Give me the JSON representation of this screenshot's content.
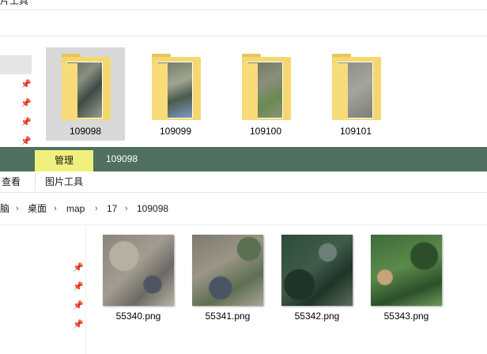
{
  "top_window": {
    "title_fragment": "片工具",
    "folders": [
      {
        "name": "109098",
        "selected": true
      },
      {
        "name": "109099",
        "selected": false
      },
      {
        "name": "109100",
        "selected": false
      },
      {
        "name": "109101",
        "selected": false
      }
    ]
  },
  "ribbon": {
    "context_tab": "管理",
    "folder_title": "109098",
    "view_label": "查看",
    "picture_tools_label": "图片工具"
  },
  "address_bar": {
    "crumbs": [
      "脑",
      "桌面",
      "map",
      "17",
      "109098"
    ]
  },
  "files": [
    {
      "name": "55340.png",
      "palette": [
        "#8a857c",
        "#a39c8f",
        "#6b6a66",
        "#b8b2a4"
      ]
    },
    {
      "name": "55341.png",
      "palette": [
        "#7d7a6e",
        "#9a9586",
        "#5e6f52",
        "#a8a597"
      ]
    },
    {
      "name": "55342.png",
      "palette": [
        "#2e4a3a",
        "#3f5c4a",
        "#1f3328",
        "#5b6e5a"
      ]
    },
    {
      "name": "55343.png",
      "palette": [
        "#3f6b3a",
        "#5a8a4a",
        "#2c4f2a",
        "#c7a27a"
      ]
    }
  ],
  "colors": {
    "context_bar": "#4f6f5f",
    "context_tab": "#f0f07c",
    "folder": "#f5d76f",
    "selection": "#d9d9d9"
  }
}
